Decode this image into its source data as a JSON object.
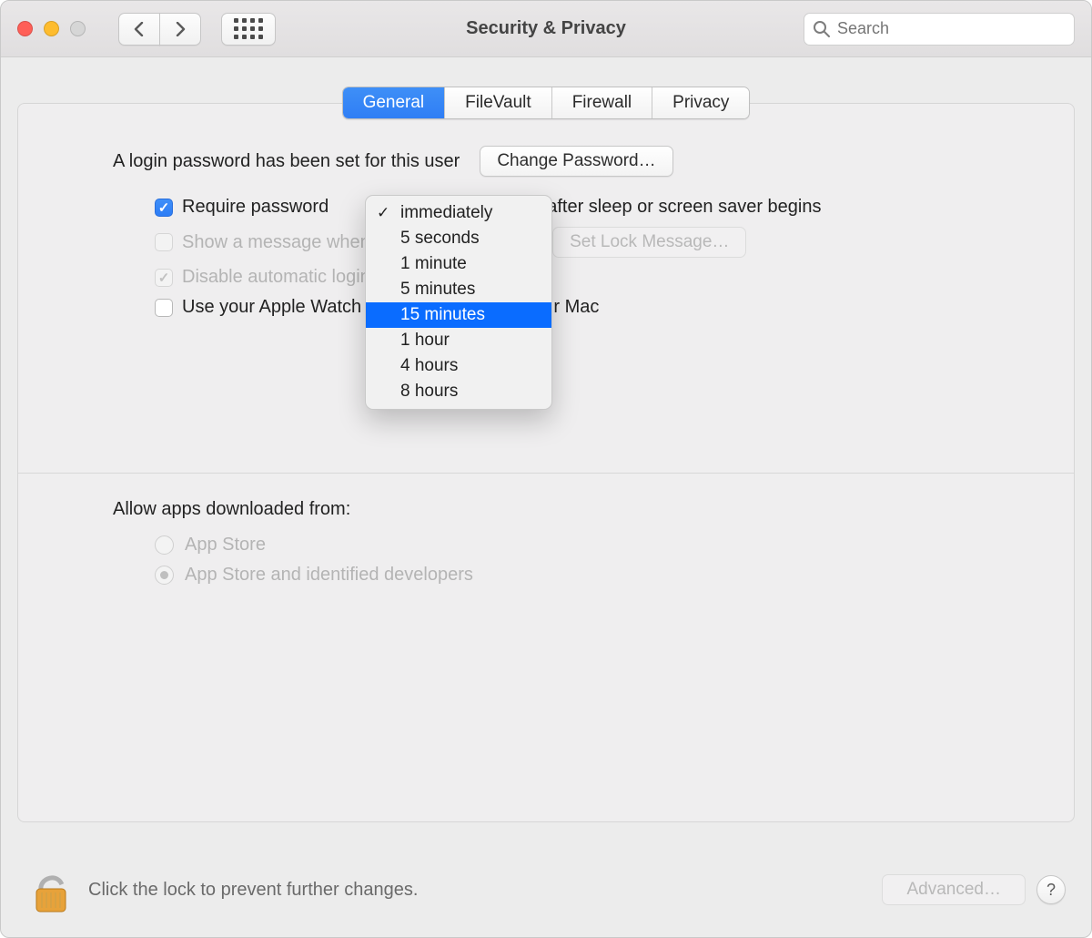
{
  "window": {
    "title": "Security & Privacy"
  },
  "search": {
    "placeholder": "Search"
  },
  "tabs": {
    "general": "General",
    "filevault": "FileVault",
    "firewall": "Firewall",
    "privacy": "Privacy"
  },
  "general": {
    "login_password_label": "A login password has been set for this user",
    "change_password_btn": "Change Password…",
    "require_password_prefix": "Require password",
    "require_password_suffix": "after sleep or screen saver begins",
    "show_message_label": "Show a message when the screen is locked",
    "set_lock_message_btn": "Set Lock Message…",
    "disable_auto_login_label": "Disable automatic login",
    "apple_watch_label": "Use your Apple Watch to unlock apps and your Mac",
    "allow_apps_label": "Allow apps downloaded from:",
    "radio_app_store": "App Store",
    "radio_app_store_dev": "App Store and identified developers"
  },
  "dropdown": {
    "options": [
      "immediately",
      "5 seconds",
      "1 minute",
      "5 minutes",
      "15 minutes",
      "1 hour",
      "4 hours",
      "8 hours"
    ],
    "checked_index": 0,
    "highlight_index": 4
  },
  "footer": {
    "lock_text": "Click the lock to prevent further changes.",
    "advanced_btn": "Advanced…"
  }
}
